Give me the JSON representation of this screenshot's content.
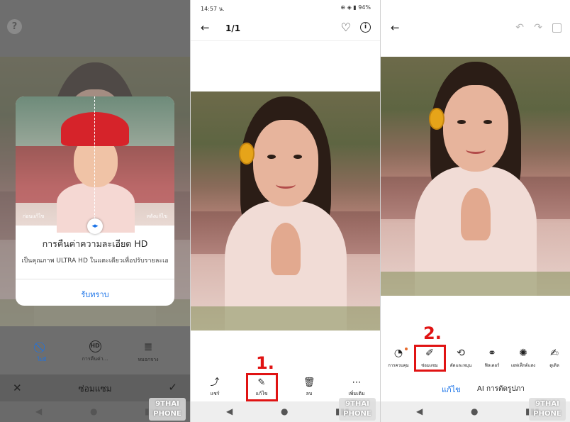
{
  "panel1": {
    "help_icon": "?",
    "dialog": {
      "before_label": "ก่อนแก้ไข",
      "after_label": "หลังแก้ไข",
      "title": "การคืนค่าความละเอียด HD",
      "description": "เป็นคุณภาพ ULTRA HD ในแตะเดียวเพื่อปรับรายละเอ",
      "ok": "รับทราบ"
    },
    "options": [
      {
        "icon": "⃠",
        "label": "ไม่มี",
        "active": true
      },
      {
        "icon": "HD",
        "label": "การคืนค่า..."
      },
      {
        "icon": "≣",
        "label": "หมอกจาง"
      }
    ],
    "bottom_title": "ซ่อมแซม"
  },
  "panel2": {
    "time": "14:57 น.",
    "status_icons": "⊕ ◈ ▮ 94%",
    "count": "1/1",
    "actions": [
      {
        "icon": "⤴",
        "label": "แชร์"
      },
      {
        "icon": "✎",
        "label": "แก้ไข"
      },
      {
        "icon": "🗑",
        "label": "ลบ"
      },
      {
        "icon": "⋯",
        "label": "เพิ่มเติม"
      }
    ],
    "step_label": "1."
  },
  "panel3": {
    "tools": [
      {
        "icon": "◔",
        "label": "การควบคุม"
      },
      {
        "icon": "✐",
        "label": "ซ่อมแซม"
      },
      {
        "icon": "⟲",
        "label": "ตัดและหมุน"
      },
      {
        "icon": "⚭",
        "label": "ฟิลเตอร์"
      },
      {
        "icon": "✺",
        "label": "เอฟเฟ็กต์แสง"
      },
      {
        "icon": "✍",
        "label": "ดูเดิล"
      }
    ],
    "mode_edit": "แก้ไข",
    "mode_ai": "AI การตัดรูปภา",
    "step_label": "2."
  },
  "watermark": {
    "line1": "9THAI",
    "line2": "PHONE"
  }
}
